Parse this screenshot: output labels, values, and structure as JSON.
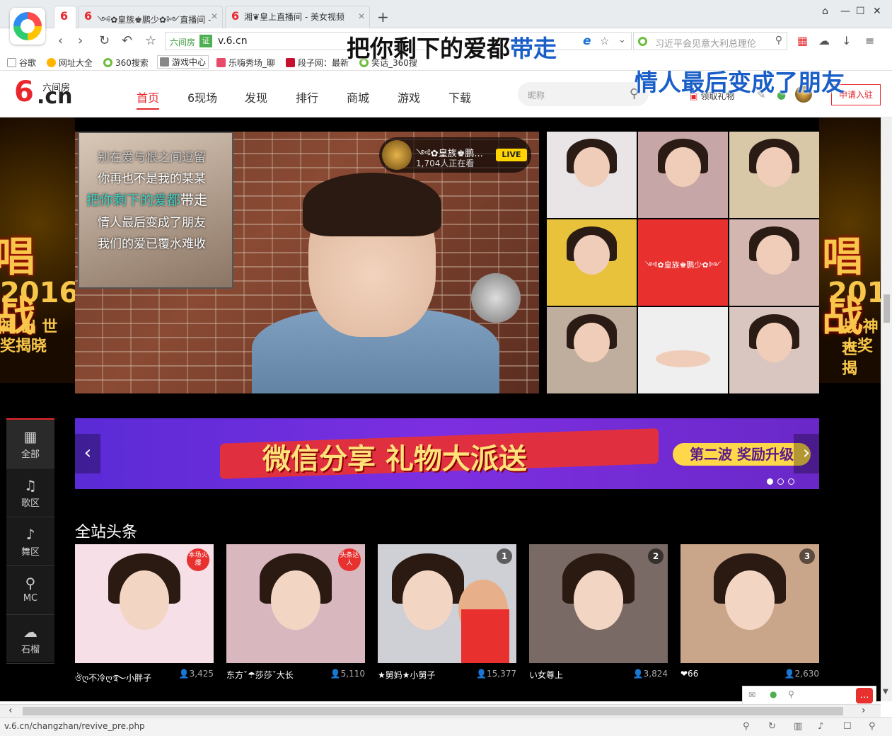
{
  "browser": {
    "tabs": [
      {
        "icon": "6",
        "title": "",
        "active": true
      },
      {
        "icon": "6",
        "title": "༺✿皇族♚鹏少✿༻直播间 -",
        "active": false
      },
      {
        "icon": "6",
        "title": "湘❦皇上直播间 - 美女视频",
        "active": false
      }
    ],
    "address": {
      "site_name": "六间房",
      "cert": "证",
      "url": "v.6.cn"
    },
    "search_placeholder": "习近平会见意大利总理伦",
    "bookmarks": [
      "谷歌",
      "网址大全",
      "360搜索",
      "游戏中心",
      "乐嗨秀场_聊",
      "段子网：最新",
      "笑话_360搜"
    ],
    "status_url": "v.6.cn/changzhan/revive_pre.php"
  },
  "overlay_lyrics": {
    "line1_a": "把你剩下的爱都",
    "line1_b": "带走",
    "line2": "情人最后变成了朋友"
  },
  "site": {
    "logo": {
      "top": "六间房",
      "six": "6",
      "cn": ".cn"
    },
    "nav": [
      "首页",
      "6现场",
      "发现",
      "排行",
      "商城",
      "游戏",
      "下载"
    ],
    "nick_placeholder": "昵称",
    "gift_label": "领取礼物",
    "apply_label": "申请入驻"
  },
  "side_ads": {
    "big": "唱战",
    "year": "2016",
    "line1": "神 出 世",
    "line2": "奖揭晓",
    "right_line1": "战 神 世",
    "right_line2": "大奖揭"
  },
  "player": {
    "lyrics": [
      "别在爱与恨之间逗留",
      "你再也不是我的某某",
      "把你剩下的爱都带走",
      "情人最后变成了朋友",
      "我们的爱已覆水难收"
    ],
    "lyric_hl": "把你剩下的爱都",
    "lyric_hl_rest": "带走",
    "streamer_name": "༺✿皇族♚鹏...",
    "viewers": "1,704人正在看",
    "live": "LIVE"
  },
  "thumb_red_text": "༺✿皇族♚鹏少✿༻",
  "banner": {
    "main": "微信分享  礼物大派送",
    "tag": "第二波 奖励升级",
    "prev": "‹",
    "next": "›"
  },
  "left_menu": [
    {
      "icon": "▦",
      "label": "全部"
    },
    {
      "icon": "♫",
      "label": "歌区"
    },
    {
      "icon": "♪",
      "label": "舞区"
    },
    {
      "icon": "⚲",
      "label": "MC"
    },
    {
      "icon": "☁",
      "label": "石榴"
    }
  ],
  "headline_title": "全站头条",
  "cards": [
    {
      "badge": "本场火爆",
      "rank": "",
      "name": "ঔღ不冷ღ࿐小胖子",
      "count": "3,425"
    },
    {
      "badge": "头条达人",
      "rank": "",
      "name": "东方ˇ☂莎莎ˇ大长",
      "count": "5,110"
    },
    {
      "badge": "",
      "rank": "1",
      "name": "★舅妈★小舅子",
      "count": "15,377"
    },
    {
      "badge": "",
      "rank": "2",
      "name": "い女尊上",
      "count": "3,824"
    },
    {
      "badge": "",
      "rank": "3",
      "name": "❤66",
      "count": "2,630"
    }
  ],
  "colors": {
    "brand": "#e8262c",
    "accent_green": "#4caf50",
    "banner_purple": "#6a28c8"
  }
}
